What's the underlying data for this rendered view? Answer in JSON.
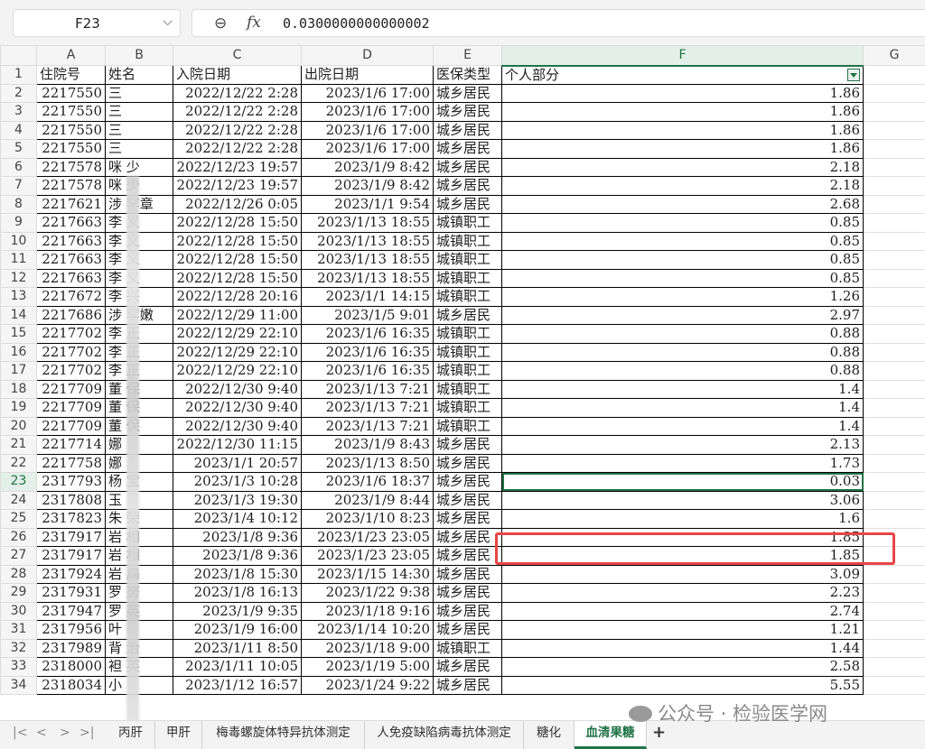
{
  "formula_bar": {
    "cell_ref": "F23",
    "formula_value": "0.0300000000000002",
    "zoom_icon": "zoom-icon",
    "fx_label": "fx"
  },
  "columns": [
    "A",
    "B",
    "C",
    "D",
    "E",
    "F",
    "G"
  ],
  "header_row": {
    "row": "1",
    "cells": [
      "住院号",
      "姓名",
      "入院日期",
      "出院日期",
      "医保类型",
      "个人部分"
    ]
  },
  "rows": [
    {
      "row": "2",
      "id": "2217550",
      "name": "三",
      "in": "2022/12/22 2:28",
      "out": "2023/1/6 17:00",
      "type": "城乡居民",
      "amount": "1.86"
    },
    {
      "row": "3",
      "id": "2217550",
      "name": "三",
      "in": "2022/12/22 2:28",
      "out": "2023/1/6 17:00",
      "type": "城乡居民",
      "amount": "1.86"
    },
    {
      "row": "4",
      "id": "2217550",
      "name": "三",
      "in": "2022/12/22 2:28",
      "out": "2023/1/6 17:00",
      "type": "城乡居民",
      "amount": "1.86"
    },
    {
      "row": "5",
      "id": "2217550",
      "name": "三",
      "in": "2022/12/22 2:28",
      "out": "2023/1/6 17:00",
      "type": "城乡居民",
      "amount": "1.86"
    },
    {
      "row": "6",
      "id": "2217578",
      "name": "咪  少",
      "in": "2022/12/23 19:57",
      "out": "2023/1/9 8:42",
      "type": "城乡居民",
      "amount": "2.18"
    },
    {
      "row": "7",
      "id": "2217578",
      "name": "咪  少",
      "in": "2022/12/23 19:57",
      "out": "2023/1/9 8:42",
      "type": "城乡居民",
      "amount": "2.18"
    },
    {
      "row": "8",
      "id": "2217621",
      "name": "涉  罕章",
      "in": "2022/12/26 0:05",
      "out": "2023/1/1 9:54",
      "type": "城乡居民",
      "amount": "2.68"
    },
    {
      "row": "9",
      "id": "2217663",
      "name": "李  义",
      "in": "2022/12/28 15:50",
      "out": "2023/1/13 18:55",
      "type": "城镇职工",
      "amount": "0.85"
    },
    {
      "row": "10",
      "id": "2217663",
      "name": "李  义",
      "in": "2022/12/28 15:50",
      "out": "2023/1/13 18:55",
      "type": "城镇职工",
      "amount": "0.85"
    },
    {
      "row": "11",
      "id": "2217663",
      "name": "李  义",
      "in": "2022/12/28 15:50",
      "out": "2023/1/13 18:55",
      "type": "城镇职工",
      "amount": "0.85"
    },
    {
      "row": "12",
      "id": "2217663",
      "name": "李  义",
      "in": "2022/12/28 15:50",
      "out": "2023/1/13 18:55",
      "type": "城镇职工",
      "amount": "0.85"
    },
    {
      "row": "13",
      "id": "2217672",
      "name": "李  兴",
      "in": "2022/12/28 20:16",
      "out": "2023/1/1 14:15",
      "type": "城镇职工",
      "amount": "1.26"
    },
    {
      "row": "14",
      "id": "2217686",
      "name": "涉  罕嫩",
      "in": "2022/12/29 11:00",
      "out": "2023/1/5 9:01",
      "type": "城乡居民",
      "amount": "2.97"
    },
    {
      "row": "15",
      "id": "2217702",
      "name": "李  正",
      "in": "2022/12/29 22:10",
      "out": "2023/1/6 16:35",
      "type": "城镇职工",
      "amount": "0.88"
    },
    {
      "row": "16",
      "id": "2217702",
      "name": "李  正",
      "in": "2022/12/29 22:10",
      "out": "2023/1/6 16:35",
      "type": "城镇职工",
      "amount": "0.88"
    },
    {
      "row": "17",
      "id": "2217702",
      "name": "李  正",
      "in": "2022/12/29 22:10",
      "out": "2023/1/6 16:35",
      "type": "城镇职工",
      "amount": "0.88"
    },
    {
      "row": "18",
      "id": "2217709",
      "name": "董  保",
      "in": "2022/12/30 9:40",
      "out": "2023/1/13 7:21",
      "type": "城镇职工",
      "amount": "1.4"
    },
    {
      "row": "19",
      "id": "2217709",
      "name": "董  保",
      "in": "2022/12/30 9:40",
      "out": "2023/1/13 7:21",
      "type": "城镇职工",
      "amount": "1.4"
    },
    {
      "row": "20",
      "id": "2217709",
      "name": "董  保",
      "in": "2022/12/30 9:40",
      "out": "2023/1/13 7:21",
      "type": "城镇职工",
      "amount": "1.4"
    },
    {
      "row": "21",
      "id": "2217714",
      "name": "娜",
      "in": "2022/12/30 11:15",
      "out": "2023/1/9 8:43",
      "type": "城乡居民",
      "amount": "2.13"
    },
    {
      "row": "22",
      "id": "2217758",
      "name": "娜",
      "in": "2023/1/1 20:57",
      "out": "2023/1/13 8:50",
      "type": "城乡居民",
      "amount": "1.73"
    },
    {
      "row": "23",
      "id": "2317793",
      "name": "杨  宝",
      "in": "2023/1/3 10:28",
      "out": "2023/1/6 18:37",
      "type": "城乡居民",
      "amount": "0.03"
    },
    {
      "row": "24",
      "id": "2317808",
      "name": "玉",
      "in": "2023/1/3 19:30",
      "out": "2023/1/9 8:44",
      "type": "城乡居民",
      "amount": "3.06"
    },
    {
      "row": "25",
      "id": "2317823",
      "name": "朱  荣",
      "in": "2023/1/4 10:12",
      "out": "2023/1/10 8:23",
      "type": "城乡居民",
      "amount": "1.6"
    },
    {
      "row": "26",
      "id": "2317917",
      "name": "岩  相",
      "in": "2023/1/8 9:36",
      "out": "2023/1/23 23:05",
      "type": "城乡居民",
      "amount": "1.85"
    },
    {
      "row": "27",
      "id": "2317917",
      "name": "岩  相",
      "in": "2023/1/8 9:36",
      "out": "2023/1/23 23:05",
      "type": "城乡居民",
      "amount": "1.85"
    },
    {
      "row": "28",
      "id": "2317924",
      "name": "岩  扁",
      "in": "2023/1/8 15:30",
      "out": "2023/1/15 14:30",
      "type": "城乡居民",
      "amount": "3.09"
    },
    {
      "row": "29",
      "id": "2317931",
      "name": "罗  努",
      "in": "2023/1/8 16:13",
      "out": "2023/1/22 9:38",
      "type": "城乡居民",
      "amount": "2.23"
    },
    {
      "row": "30",
      "id": "2317947",
      "name": "罗  英",
      "in": "2023/1/9 9:35",
      "out": "2023/1/18 9:16",
      "type": "城乡居民",
      "amount": "2.74"
    },
    {
      "row": "31",
      "id": "2317956",
      "name": "叶",
      "in": "2023/1/9 16:00",
      "out": "2023/1/14 10:20",
      "type": "城乡居民",
      "amount": "1.21"
    },
    {
      "row": "32",
      "id": "2317989",
      "name": "背  治",
      "in": "2023/1/11 8:50",
      "out": "2023/1/18 9:00",
      "type": "城镇职工",
      "amount": "1.44"
    },
    {
      "row": "33",
      "id": "2318000",
      "name": "袒  英",
      "in": "2023/1/11 10:05",
      "out": "2023/1/19 5:00",
      "type": "城乡居民",
      "amount": "2.58"
    },
    {
      "row": "34",
      "id": "2318034",
      "name": "小",
      "in": "2023/1/12 16:57",
      "out": "2023/1/24 9:22",
      "type": "城乡居民",
      "amount": "5.55"
    }
  ],
  "tabs": [
    {
      "label": "丙肝",
      "active": false
    },
    {
      "label": "甲肝",
      "active": false
    },
    {
      "label": "梅毒螺旋体特异抗体测定",
      "active": false
    },
    {
      "label": "人免疫缺陷病毒抗体测定",
      "active": false
    },
    {
      "label": "糖化",
      "active": false
    },
    {
      "label": "血清果糖",
      "active": true
    }
  ],
  "add_tab_label": "+",
  "nav": [
    "|<",
    "<",
    ">",
    ">|"
  ],
  "watermark": "公众号 · 检验医学网",
  "colors": {
    "accent": "#217346",
    "highlight": "#e84545"
  }
}
